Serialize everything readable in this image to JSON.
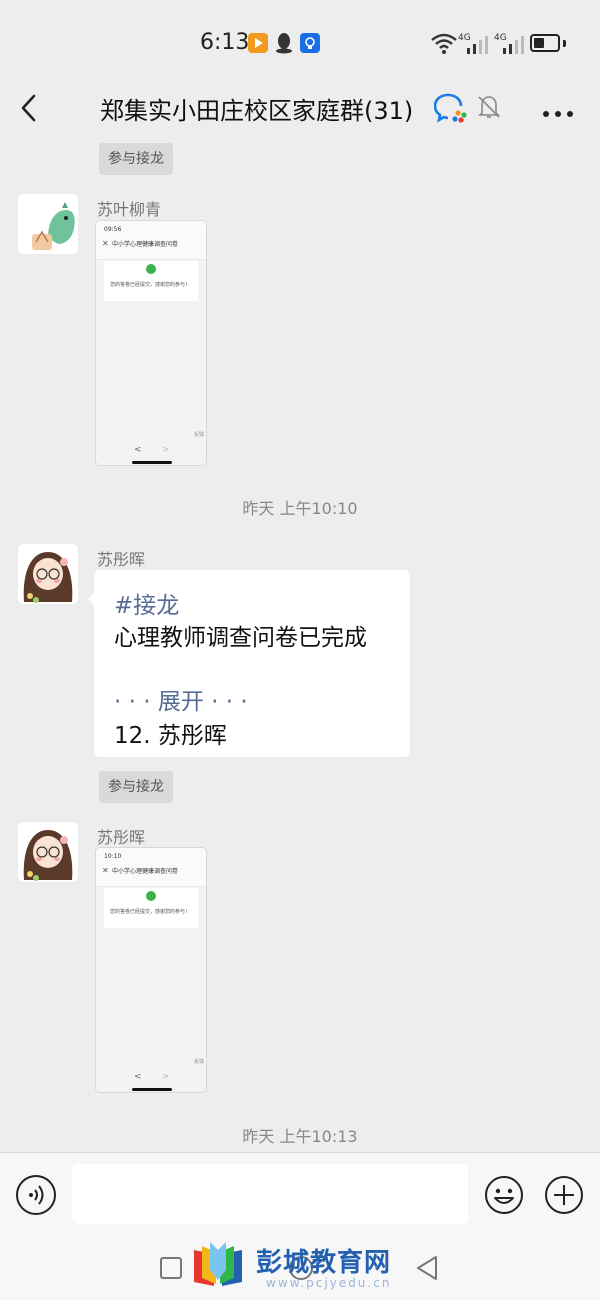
{
  "status_bar": {
    "time": "6:13",
    "network_1": "4G",
    "network_2": "4G",
    "battery_level": 0.45
  },
  "header": {
    "title": "郑集实小田庄校区家庭群(31)"
  },
  "chat": {
    "join_button_label": "参与接龙",
    "messages": [
      {
        "sender": "苏叶柳青",
        "screenshot": {
          "time": "09:56",
          "title": "中小学心理健康调查问卷",
          "message": "您的答卷已经提交，感谢您的参与！",
          "footer": "反馈"
        }
      },
      {
        "sender": "苏彤晖",
        "solitaire": {
          "hashtag": "#接龙",
          "line": "心理教师调查问卷已完成",
          "expand": "· · · 展开 · · ·",
          "entry": "12. 苏彤晖"
        }
      },
      {
        "sender": "苏彤晖",
        "screenshot": {
          "time": "10:10",
          "title": "中小学心理健康调查问卷",
          "message": "您的答卷已经提交，感谢您的参与！",
          "footer": "反馈"
        }
      }
    ],
    "timestamps": [
      "昨天 上午10:10",
      "昨天 上午10:13"
    ]
  },
  "input": {
    "placeholder": ""
  },
  "watermark": {
    "title": "彭城教育网",
    "url": "www.pcjyedu.cn"
  },
  "colors": {
    "background": "#ededed",
    "link_blue": "#576b95",
    "check_green": "#3bb34a",
    "watermark_blue": "#2360b0"
  }
}
